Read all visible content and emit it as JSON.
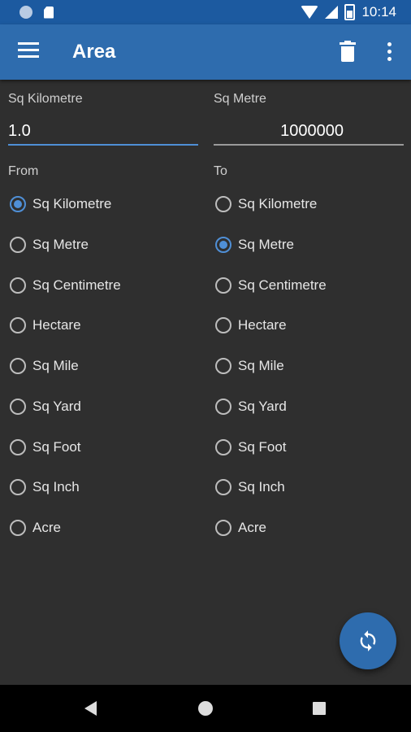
{
  "status_bar": {
    "time": "10:14"
  },
  "app_bar": {
    "title": "Area",
    "menu_icon": "menu-icon",
    "delete_icon": "trash-icon",
    "more_icon": "more-vert-icon"
  },
  "input_from": {
    "label": "Sq Kilometre",
    "value": "1.0"
  },
  "input_to": {
    "label": "Sq Metre",
    "value": "1000000"
  },
  "from": {
    "label": "From",
    "selected": "Sq Kilometre",
    "options": [
      "Sq Kilometre",
      "Sq Metre",
      "Sq Centimetre",
      "Hectare",
      "Sq Mile",
      "Sq Yard",
      "Sq Foot",
      "Sq Inch",
      "Acre"
    ]
  },
  "to": {
    "label": "To",
    "selected": "Sq Metre",
    "options": [
      "Sq Kilometre",
      "Sq Metre",
      "Sq Centimetre",
      "Hectare",
      "Sq Mile",
      "Sq Yard",
      "Sq Foot",
      "Sq Inch",
      "Acre"
    ]
  },
  "fab": {
    "icon": "swap-refresh-icon"
  },
  "colors": {
    "primary": "#2e6cae",
    "status_bar": "#1c5aa0",
    "accent": "#4f8fd6",
    "background": "#2f2f2f"
  }
}
